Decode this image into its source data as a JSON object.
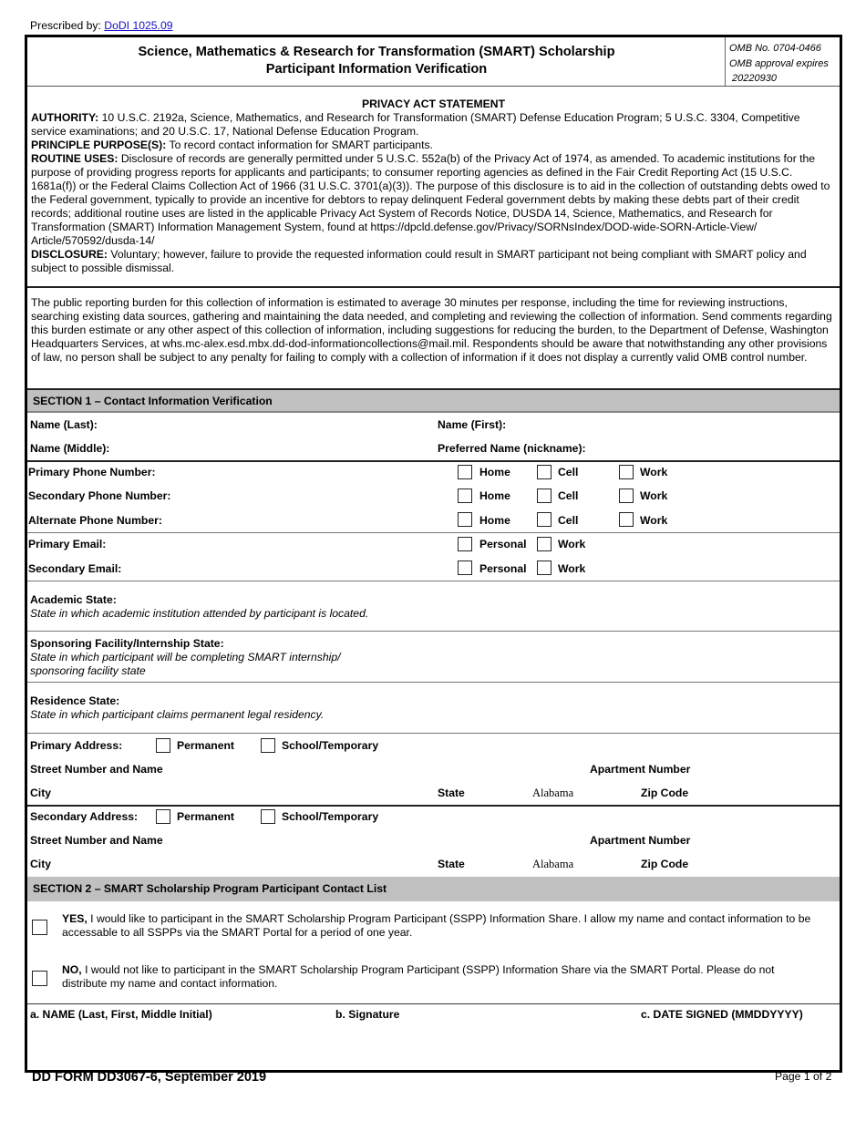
{
  "prescribed": {
    "label": "Prescribed by:",
    "link_text": "DoDI 1025.09"
  },
  "header": {
    "title_line1": "Science, Mathematics & Research for Transformation (SMART) Scholarship",
    "title_line2": "Participant Information Verification",
    "omb_no": "OMB No. 0704-0466",
    "omb_expires_label": "OMB approval expires",
    "omb_expires_date": "20220930"
  },
  "privacy": {
    "heading": "PRIVACY ACT STATEMENT",
    "authority_label": "AUTHORITY:",
    "authority_text": "10 U.S.C. 2192a, Science, Mathematics, and Research for Transformation (SMART) Defense Education Program; 5 U.S.C. 3304, Competitive service examinations; and 20 U.S.C. 17, National Defense Education Program.",
    "purpose_label": "PRINCIPLE PURPOSE(S):",
    "purpose_text": "To record contact information for SMART participants.",
    "routine_label": "ROUTINE USES:",
    "routine_text": "Disclosure of records are generally permitted under 5 U.S.C. 552a(b) of the Privacy Act of 1974, as amended.  To academic institutions for the purpose of providing progress reports for applicants and participants; to consumer reporting agencies as defined in the Fair Credit Reporting Act (15 U.S.C. 1681a(f)) or the Federal Claims Collection Act of 1966 (31 U.S.C. 3701(a)(3)).  The purpose of this disclosure is to aid in the collection of outstanding debts owed to the Federal government, typically to provide an incentive for debtors to repay delinquent Federal government debts by making these debts part of their credit records; additional routine uses are listed in the applicable Privacy Act System of Records Notice, DUSDA 14, Science, Mathematics, and Research for Transformation (SMART) Information Management System, found at https://dpcld.defense.gov/Privacy/SORNsIndex/DOD-wide-SORN-Article-View/ Article/570592/dusda-14/",
    "disclosure_label": "DISCLOSURE:",
    "disclosure_text": "Voluntary; however, failure to provide the requested information could result in SMART participant not being compliant with SMART policy and subject to possible dismissal."
  },
  "burden": {
    "text": "The public reporting burden for this collection of information is estimated to average 30 minutes per response, including the time for reviewing instructions, searching existing data sources, gathering and maintaining the data needed, and completing and reviewing the collection of information. Send comments regarding this burden estimate or any other aspect of this collection of information, including suggestions for reducing the burden, to the Department of Defense, Washington Headquarters Services, at whs.mc-alex.esd.mbx.dd-dod-informationcollections@mail.mil. Respondents should be aware that notwithstanding any other provisions of law, no person shall be subject to any penalty for failing to comply with a collection of information if it does not display a currently valid OMB control number."
  },
  "section1": {
    "heading": "SECTION 1 – Contact Information Verification",
    "name_last": "Name (Last):",
    "name_first": "Name (First):",
    "name_middle": "Name (Middle):",
    "preferred_name": "Preferred Name (nickname):",
    "phones": [
      {
        "label": "Primary Phone Number:",
        "options": [
          "Home",
          "Cell",
          "Work"
        ]
      },
      {
        "label": "Secondary Phone Number:",
        "options": [
          "Home",
          "Cell",
          "Work"
        ]
      },
      {
        "label": "Alternate Phone Number:",
        "options": [
          "Home",
          "Cell",
          "Work"
        ]
      }
    ],
    "emails": [
      {
        "label": "Primary Email:",
        "options": [
          "Personal",
          "Work"
        ]
      },
      {
        "label": "Secondary Email:",
        "options": [
          "Personal",
          "Work"
        ]
      }
    ],
    "academic_state": {
      "label": "Academic State:",
      "hint": "State in which academic institution attended by participant is located."
    },
    "sponsoring_state": {
      "label": "Sponsoring Facility/Internship State:",
      "hint_line1": "State in which participant will be completing SMART internship/",
      "hint_line2": "sponsoring facility state"
    },
    "residence_state": {
      "label": "Residence State:",
      "hint": "State in which participant claims permanent legal residency."
    },
    "addresses": [
      {
        "label": "Primary Address:",
        "options": [
          "Permanent",
          "School/Temporary"
        ],
        "street": "Street Number and Name",
        "apt": "Apartment Number",
        "city": "City",
        "state_label": "State",
        "state_value": "Alabama",
        "zip": "Zip Code"
      },
      {
        "label": "Secondary Address:",
        "options": [
          "Permanent",
          "School/Temporary"
        ],
        "street": "Street Number and Name",
        "apt": "Apartment Number",
        "city": "City",
        "state_label": "State",
        "state_value": "Alabama",
        "zip": "Zip Code"
      }
    ]
  },
  "section2": {
    "heading": "SECTION 2 – SMART Scholarship Program Participant Contact List",
    "yes_label": "YES,",
    "yes_text": "I would like to participant in the SMART Scholarship Program Participant (SSPP) Information Share. I allow my name and contact information to be accessable to all SSPPs via the SMART Portal for a period of one year.",
    "no_label": "NO,",
    "no_text": "I would not like to participant in the SMART Scholarship Program Participant (SSPP) Information Share via the SMART Portal. Please do not distribute my name and contact information.",
    "sig_name": "a. NAME (Last, First, Middle Initial)",
    "sig_signature": "b. Signature",
    "sig_date": "c. DATE SIGNED (MMDDYYYY)"
  },
  "footer": {
    "form_id": "DD FORM DD3067-6, September 2019",
    "page": "Page 1 of 2"
  }
}
